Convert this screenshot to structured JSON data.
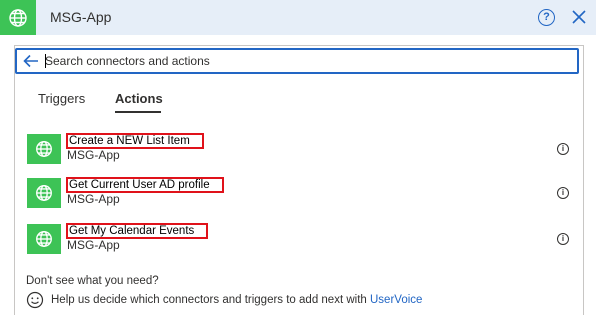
{
  "header": {
    "title": "MSG-App",
    "help_label": "?",
    "app_icon": "globe-icon",
    "close_icon": "close-icon"
  },
  "search": {
    "placeholder": "Search connectors and actions",
    "value": ""
  },
  "tabs": [
    {
      "label": "Triggers",
      "selected": false
    },
    {
      "label": "Actions",
      "selected": true
    }
  ],
  "actions": [
    {
      "title": "Create a NEW List Item",
      "connector": "MSG-App",
      "info": "i"
    },
    {
      "title": "Get Current User AD profile",
      "connector": "MSG-App",
      "info": "i"
    },
    {
      "title": "Get My Calendar Events",
      "connector": "MSG-App",
      "info": "i"
    }
  ],
  "footer": {
    "question": "Don't see what you need?",
    "help_text": "Help us decide which connectors and triggers to add next with",
    "link_text": "UserVoice"
  },
  "colors": {
    "accent": "#2266c4",
    "connector_tile": "#3dc356",
    "highlight_box": "#e0121a",
    "header_bg": "#e6eef8"
  }
}
